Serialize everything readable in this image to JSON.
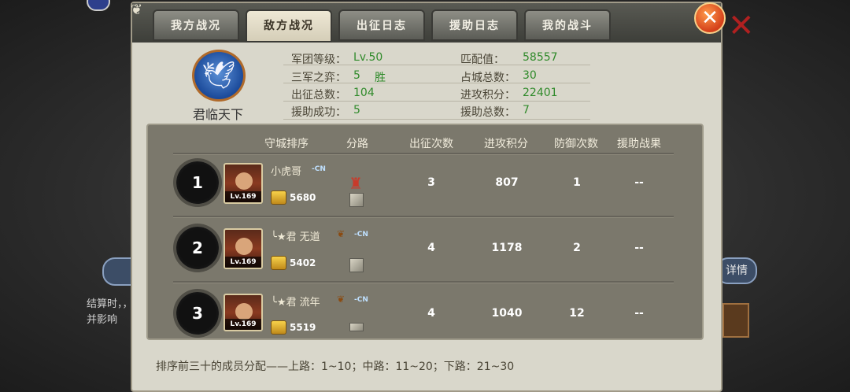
{
  "tabs": [
    {
      "label": "我方战况"
    },
    {
      "label": "敌方战况"
    },
    {
      "label": "出征日志"
    },
    {
      "label": "援助日志"
    },
    {
      "label": "我的战斗"
    }
  ],
  "active_tab": "敌方战况",
  "close_label": "✕",
  "legion": {
    "name": "君临天下"
  },
  "stats": {
    "legion_level_label": "军团等级：",
    "legion_level_value": "Lv.50",
    "match_label": "匹配值：",
    "match_value": "58557",
    "three_army_label": "三军之弈：",
    "three_army_value": "5",
    "three_army_unit": "胜",
    "cities_label": "占城总数：",
    "cities_value": "30",
    "expedition_label": "出征总数：",
    "expedition_value": "104",
    "attack_points_label": "进攻积分：",
    "attack_points_value": "22401",
    "assist_success_label": "援助成功：",
    "assist_success_value": "5",
    "assist_total_label": "援助总数：",
    "assist_total_value": "7"
  },
  "table": {
    "headers": [
      "守城排序",
      "分路",
      "出征次数",
      "进攻积分",
      "防御次数",
      "援助战果"
    ],
    "rows": [
      {
        "rank": "1",
        "name": "小虎哥",
        "tag": "-CN",
        "level": "Lv.169",
        "power": "5680",
        "expeditions": "3",
        "attack_points": "807",
        "defenses": "1",
        "assist": "--"
      },
      {
        "rank": "2",
        "name": "╰★君 无道",
        "tag": "-CN",
        "level": "Lv.169",
        "power": "5402",
        "expeditions": "4",
        "attack_points": "1178",
        "defenses": "2",
        "assist": "--"
      },
      {
        "rank": "3",
        "name": "╰★君 流年",
        "tag": "-CN",
        "level": "Lv.169",
        "power": "5519",
        "expeditions": "4",
        "attack_points": "1040",
        "defenses": "12",
        "assist": "--"
      }
    ]
  },
  "footer": "排序前三十的成员分配——上路：1~10；中路：11~20；下路：21~30",
  "background": {
    "right_button": "详情",
    "left_text": "结算时，，并影响"
  },
  "colors": {
    "value_green": "#2f8a2a",
    "panel_bg": "#d9d7cb",
    "table_bg": "#7b786c",
    "close_orange": "#d4401a"
  },
  "icons": [
    "eagle-emblem-icon",
    "gold-ingot-icon",
    "route-icon",
    "war-banner-icon",
    "leaf-icon",
    "close-icon"
  ]
}
